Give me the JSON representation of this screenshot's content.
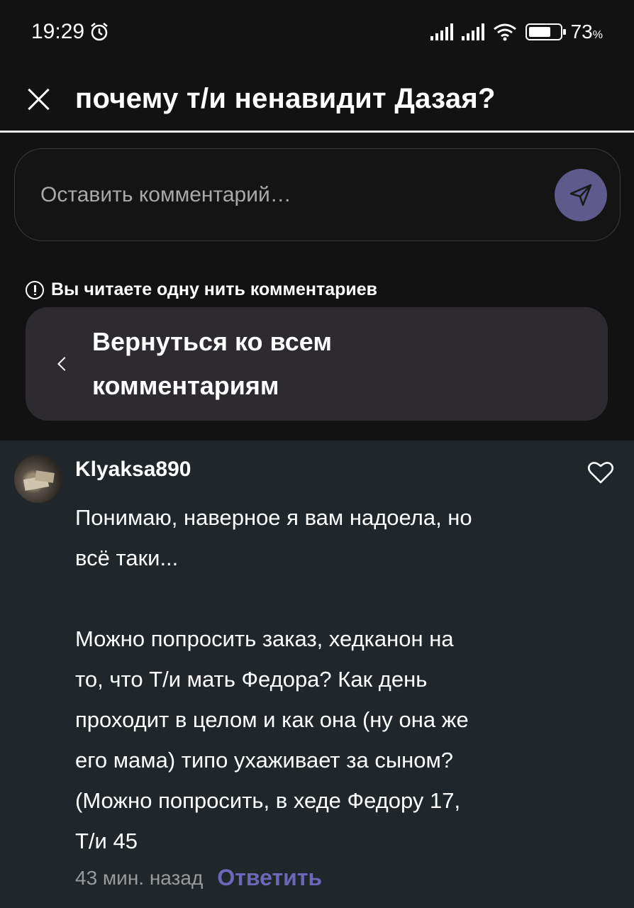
{
  "status_bar": {
    "time": "19:29",
    "battery_percent": "73",
    "battery_unit": "%",
    "battery_level": 0.73
  },
  "header": {
    "title": "почему т/и ненавидит Дазая?"
  },
  "comment_input": {
    "placeholder": "Оставить комментарий…"
  },
  "thread_notice": {
    "text": "Вы читаете одну нить комментариев"
  },
  "back_button": {
    "label": "Вернуться ко всем комментариям"
  },
  "comment": {
    "username": "Klyaksa890",
    "text": "Понимаю, наверное я вам надоела, но\nвсё таки...\n\nМожно попросить заказ, хедканон на\nто, что Т/и мать Федора? Как день\nпроходит в целом и как она (ну она же\nего мама) типо ухаживает за сыном?\n(Можно попросить, в хеде Федору 17,\nТ/и 45",
    "time_ago": "43 мин. назад",
    "reply_label": "Ответить"
  },
  "colors": {
    "accent": "#6e66b8",
    "send_button": "#5e5a8c",
    "thread_bg": "#202629",
    "app_bg": "#121212"
  }
}
